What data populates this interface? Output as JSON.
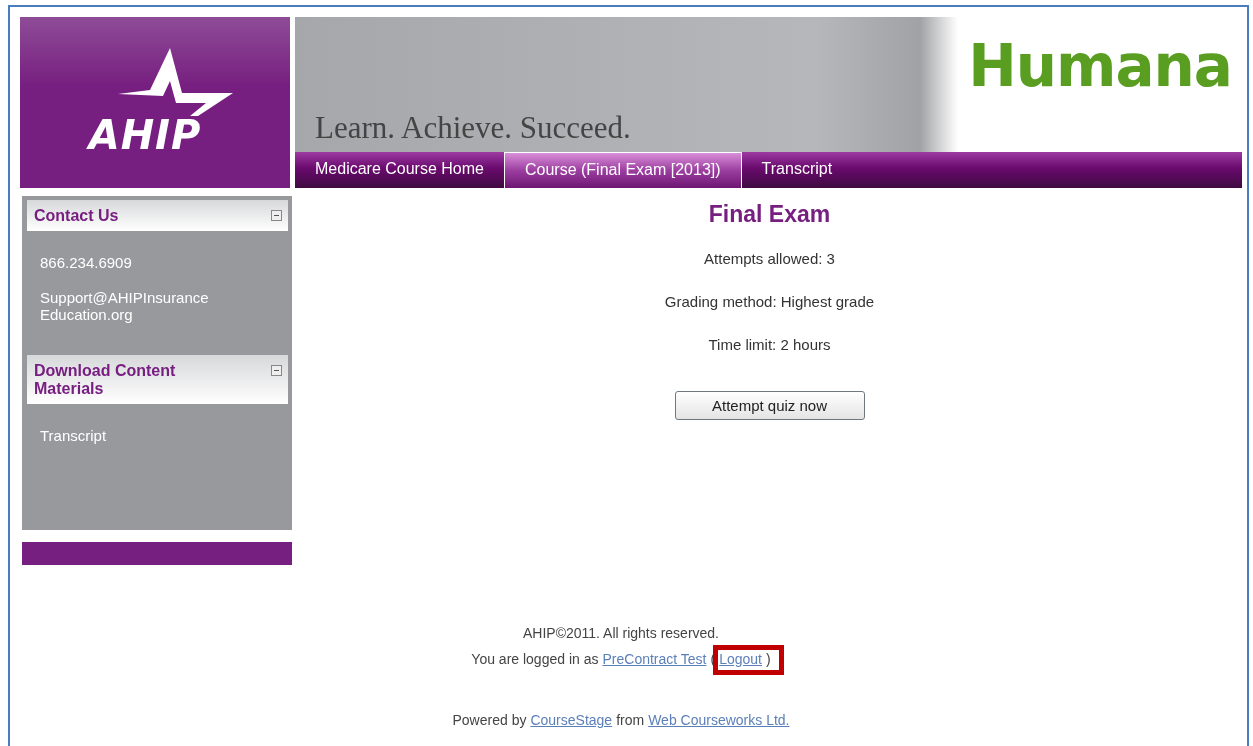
{
  "header": {
    "logo": "AHIP",
    "tagline": "Learn. Achieve. Succeed.",
    "brand": "Humana"
  },
  "nav_tabs": [
    {
      "label": "Medicare Course Home",
      "selected": false
    },
    {
      "label": "Course (Final Exam [2013])",
      "selected": true
    },
    {
      "label": "Transcript",
      "selected": false
    }
  ],
  "sidebar": {
    "blocks": [
      {
        "title": "Contact Us",
        "expanded": true,
        "items": [
          "866.234.6909",
          "Support@AHIPInsurance Education.org"
        ]
      },
      {
        "title": "Download Content Materials",
        "expanded": true,
        "items": [
          "Transcript"
        ]
      }
    ]
  },
  "main": {
    "title": "Final Exam",
    "details": [
      "Attempts allowed: 3",
      "Grading method: Highest grade",
      "Time limit: 2 hours"
    ],
    "button": "Attempt quiz now"
  },
  "footer": {
    "copyright": "AHIP©2011. All rights reserved.",
    "login_line": [
      {
        "kind": "text",
        "text": "You are logged in as"
      },
      {
        "kind": "link",
        "text": "PreContract Test",
        "highlighted": false
      },
      {
        "kind": "text",
        "text": "("
      },
      {
        "kind": "link",
        "text": "Logout",
        "highlighted": true
      },
      {
        "kind": "text",
        "text": ")"
      }
    ],
    "powered_line": [
      {
        "kind": "text",
        "text": "Powered by"
      },
      {
        "kind": "link",
        "text": "CourseStage",
        "highlighted": false
      },
      {
        "kind": "text",
        "text": "from"
      },
      {
        "kind": "link",
        "text": "Web Courseworks Ltd.",
        "highlighted": false
      }
    ]
  }
}
